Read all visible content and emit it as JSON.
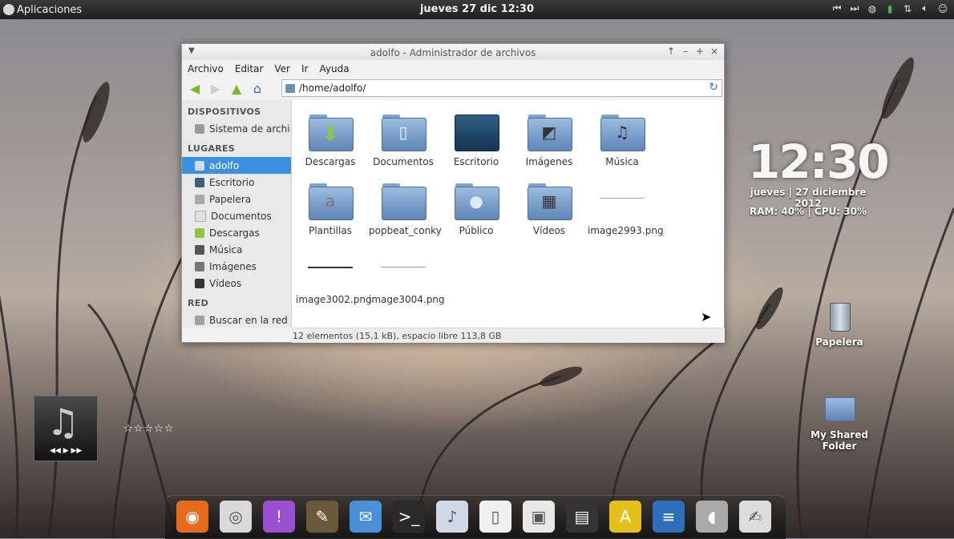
{
  "top_panel": {
    "apps_label": "Aplicaciones",
    "clock": "jueves 27 dic 12:30",
    "indicators": [
      "prev-track-icon",
      "next-track-icon",
      "network-icon",
      "battery-icon",
      "transfer-icon",
      "volume-icon",
      "user-icon"
    ]
  },
  "window": {
    "title": "adolfo - Administrador de archivos",
    "menu": [
      "Archivo",
      "Editar",
      "Ver",
      "Ir",
      "Ayuda"
    ],
    "location": "/home/adolfo/",
    "sidebar": {
      "devices_heading": "DISPOSITIVOS",
      "devices": [
        {
          "label": "Sistema de archi…"
        }
      ],
      "places_heading": "LUGARES",
      "places": [
        {
          "label": "adolfo",
          "active": true
        },
        {
          "label": "Escritorio"
        },
        {
          "label": "Papelera"
        },
        {
          "label": "Documentos"
        },
        {
          "label": "Descargas"
        },
        {
          "label": "Música"
        },
        {
          "label": "Imágenes"
        },
        {
          "label": "Vídeos"
        }
      ],
      "network_heading": "RED",
      "network": [
        {
          "label": "Buscar en la red"
        }
      ]
    },
    "files": [
      {
        "name": "Descargas",
        "kind": "folder",
        "glyph": "⬇"
      },
      {
        "name": "Documentos",
        "kind": "folder",
        "glyph": "▯"
      },
      {
        "name": "Escritorio",
        "kind": "desktop",
        "glyph": ""
      },
      {
        "name": "Imágenes",
        "kind": "folder",
        "glyph": "◩"
      },
      {
        "name": "Música",
        "kind": "folder",
        "glyph": "♫"
      },
      {
        "name": "Plantillas",
        "kind": "folder",
        "glyph": "a"
      },
      {
        "name": "popbeat_conky",
        "kind": "folder",
        "glyph": ""
      },
      {
        "name": "Público",
        "kind": "folder",
        "glyph": "●"
      },
      {
        "name": "Vídeos",
        "kind": "folder",
        "glyph": "▦"
      },
      {
        "name": "image2993.png",
        "kind": "png",
        "glyph": ""
      },
      {
        "name": "image3002.png",
        "kind": "png",
        "glyph": ""
      },
      {
        "name": "image3004.png",
        "kind": "png",
        "glyph": ""
      }
    ],
    "status": "12 elementos (15,1 kB), espacio libre 113,8 GB"
  },
  "conky": {
    "time": "12:30",
    "date": "jueves | 27 diciembre 2012",
    "stats": "RAM: 40% | CPU: 30%"
  },
  "desktop_icons": [
    {
      "label": "Papelera"
    },
    {
      "label": "My Shared Folder"
    }
  ],
  "music_player": {
    "rating": "☆☆☆☆☆",
    "controls": "◀◀ ▶ ▶▶"
  },
  "dock": [
    {
      "name": "firefox-icon",
      "glyph": "◉",
      "color": "#e66a1e"
    },
    {
      "name": "disc-icon",
      "glyph": "◎",
      "color": "#d9d9d9"
    },
    {
      "name": "chat-icon",
      "glyph": "!",
      "color": "#9a4fd0"
    },
    {
      "name": "gimp-icon",
      "glyph": "✎",
      "color": "#6b5a3a"
    },
    {
      "name": "mail-icon",
      "glyph": "✉",
      "color": "#4a90d9"
    },
    {
      "name": "terminal-icon",
      "glyph": ">_",
      "color": "#2a2a2a"
    },
    {
      "name": "banshee-icon",
      "glyph": "♪",
      "color": "#cfd9e8"
    },
    {
      "name": "document-icon",
      "glyph": "▯",
      "color": "#f0f0f0"
    },
    {
      "name": "workspace-icon",
      "glyph": "▣",
      "color": "#e8e8e8"
    },
    {
      "name": "video-editor-icon",
      "glyph": "▤",
      "color": "#333"
    },
    {
      "name": "inkscape-icon",
      "glyph": "A",
      "color": "#e3c11a"
    },
    {
      "name": "writer-icon",
      "glyph": "≡",
      "color": "#2d6fb8"
    },
    {
      "name": "speaker-icon",
      "glyph": "◖",
      "color": "#aaa"
    },
    {
      "name": "text-editor-icon",
      "glyph": "✍",
      "color": "#ddd"
    }
  ]
}
